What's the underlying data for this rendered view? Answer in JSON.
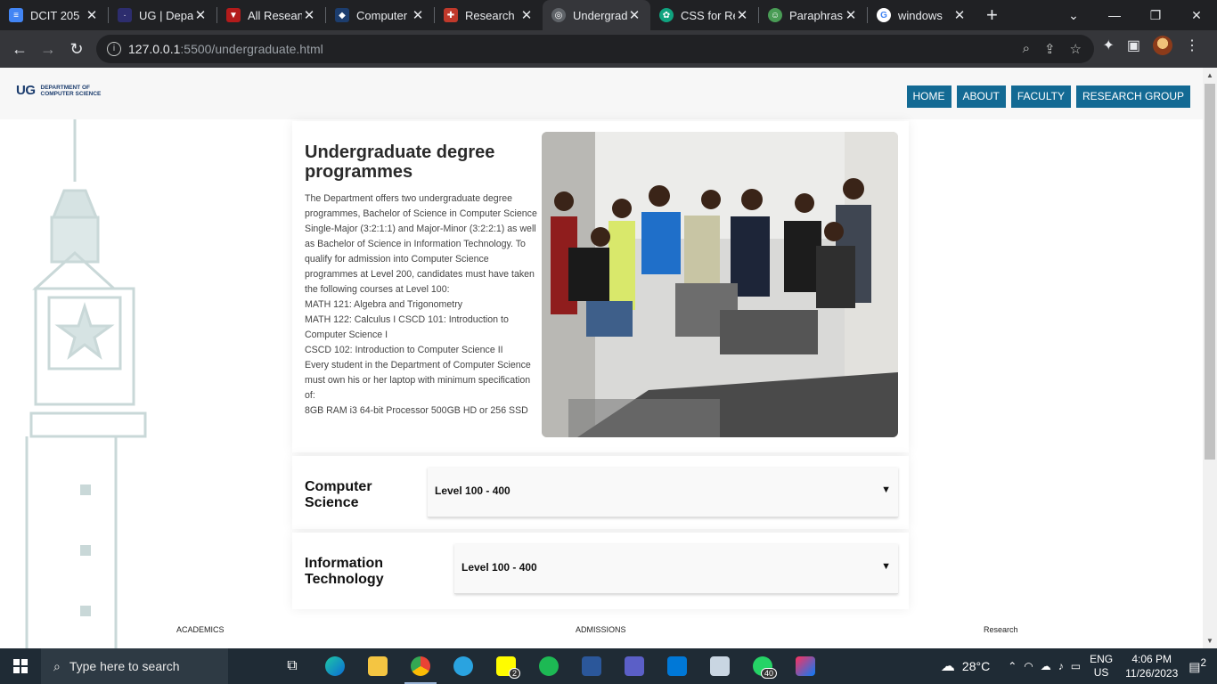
{
  "browser": {
    "tabs": [
      {
        "label": "DCIT 205",
        "color": "#4285f4"
      },
      {
        "label": "UG | Depa",
        "color": "#2d2d6e"
      },
      {
        "label": "All Resean",
        "color": "#b31b1b"
      },
      {
        "label": "Computer",
        "color": "#1c3d6e"
      },
      {
        "label": "Research",
        "color": "#c0392b"
      },
      {
        "label": "Undergrad",
        "color": "#9aa0a6"
      },
      {
        "label": "CSS for Re",
        "color": "#10a37f"
      },
      {
        "label": "Paraphras",
        "color": "#499c55"
      },
      {
        "label": "windows",
        "color": "#4285f4"
      }
    ],
    "active_tab": 5,
    "url_host": "127.0.0.1",
    "url_path": ":5500/undergraduate.html"
  },
  "site": {
    "logo_mark": "UG",
    "logo_dept_line1": "DEPARTMENT OF",
    "logo_dept_line2": "COMPUTER SCIENCE",
    "nav": [
      "HOME",
      "ABOUT",
      "FACULTY",
      "RESEARCH GROUP"
    ]
  },
  "intro": {
    "title": "Undergraduate degree programmes",
    "paragraphs": [
      "The Department offers two undergraduate degree programmes, Bachelor of Science in Computer Science Single-Major (3:2:1:1) and Major-Minor (3:2:2:1) as well as Bachelor of Science in Information Technology. To qualify for admission into Computer Science programmes at Level 200, candidates must have taken the following courses at Level 100:",
      "MATH 121: Algebra and Trigonometry",
      "MATH 122: Calculus I CSCD 101: Introduction to Computer Science I",
      "CSCD 102: Introduction to Computer Science II",
      "Every student in the Department of Computer Science must own his or her laptop with minimum specification of:",
      "8GB RAM i3 64-bit Processor 500GB HD or 256 SSD"
    ]
  },
  "programmes": [
    {
      "name_line1": "Computer",
      "name_line2": "Science",
      "accordion_label": "Level 100 - 400",
      "caret": "▼"
    },
    {
      "name_line1": "Information",
      "name_line2": "Technology",
      "accordion_label": "Level 100 - 400",
      "caret": "▼"
    }
  ],
  "footer": [
    "ACADEMICS",
    "ADMISSIONS",
    "Research"
  ],
  "taskbar": {
    "search_placeholder": "Type here to search",
    "weather": "28°C",
    "lang1": "ENG",
    "lang2": "US",
    "time": "4:06 PM",
    "date": "11/26/2023",
    "snapchat_badge": "2",
    "whatsapp_badge": "40",
    "notif_count": "2"
  }
}
